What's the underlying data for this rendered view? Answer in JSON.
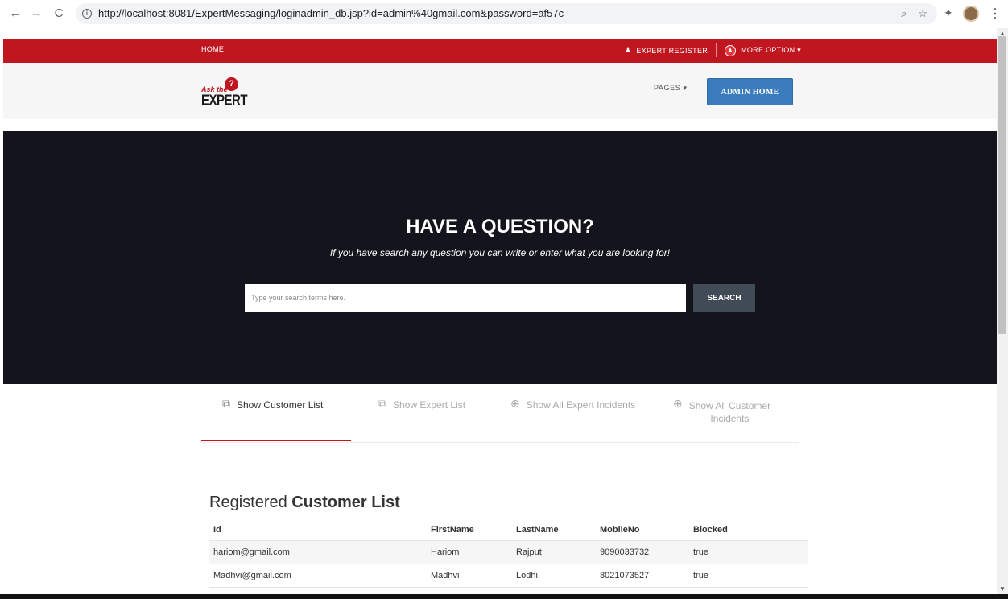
{
  "browser": {
    "url": "http://localhost:8081/ExpertMessaging/loginadmin_db.jsp?id=admin%40gmail.com&password=af57c",
    "back_icon": "←",
    "forward_icon": "→",
    "reload_icon": "C",
    "info_icon": "i",
    "zoom_icon": "⌕",
    "star_icon": "☆",
    "extension_icon": "✦",
    "menu_icon": "⋮"
  },
  "topbar": {
    "home": "HOME",
    "expert_register": "EXPERT REGISTER",
    "more_option": "MORE OPTION ▾",
    "user_plus_icon": "♟",
    "user_icon": "♟"
  },
  "header": {
    "logo_ask": "Ask the",
    "logo_q": "?",
    "logo_expert": "EXPERT",
    "pages": "PAGES ▾",
    "admin_home": "ADMIN HOME"
  },
  "hero": {
    "title": "HAVE A QUESTION?",
    "subtitle": "If you have search any question you can write or enter what you are looking for!",
    "search_placeholder": "Type your search terms here.",
    "search_button": "SEARCH"
  },
  "tabs": [
    {
      "label": "Show Customer List",
      "icon": "⧉"
    },
    {
      "label": "Show Expert List",
      "icon": "⧉"
    },
    {
      "label": "Show All Expert Incidents",
      "icon": "⊕"
    },
    {
      "label_line1": "Show All Customer",
      "label_line2": "Incidents",
      "icon": "⊕"
    }
  ],
  "section": {
    "title_light": "Registered ",
    "title_bold": "Customer List"
  },
  "table": {
    "headers": [
      "Id",
      "FirstName",
      "LastName",
      "MobileNo",
      "Blocked"
    ],
    "rows": [
      [
        "hariom@gmail.com",
        "Hariom",
        "Rajput",
        "9090033732",
        "true"
      ],
      [
        "Madhvi@gmail.com",
        "Madhvi",
        "Lodhi",
        "8021073527",
        "true"
      ]
    ]
  },
  "colors": {
    "brand_red": "#c0161f",
    "admin_blue": "#3a7cbc",
    "hero_bg": "#13141c",
    "search_btn": "#414b55"
  }
}
